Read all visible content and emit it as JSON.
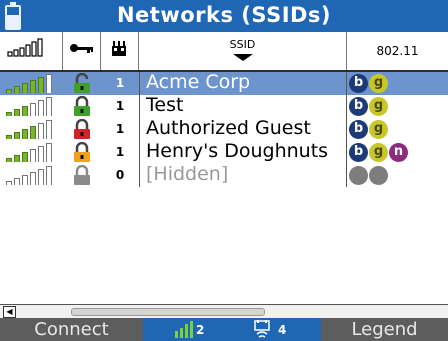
{
  "title": "Networks (SSIDs)",
  "header": {
    "signal_icon": "signal-strength-icon",
    "key_icon": "key-icon",
    "ap_icon": "access-point-icon",
    "ssid_label": "SSID",
    "std_label": "802.11"
  },
  "rows": [
    {
      "signal": 5,
      "lock": "green-open",
      "count": "1",
      "ssid": "Acme Corp",
      "standards": [
        "b",
        "g"
      ],
      "selected": true
    },
    {
      "signal": 3,
      "lock": "green",
      "count": "1",
      "ssid": "Test",
      "standards": [
        "b",
        "g"
      ]
    },
    {
      "signal": 4,
      "lock": "red",
      "count": "1",
      "ssid": "Authorized Guest",
      "standards": [
        "b",
        "g"
      ]
    },
    {
      "signal": 3,
      "lock": "orange",
      "count": "1",
      "ssid": "Henry's Doughnuts",
      "standards": [
        "b",
        "g",
        "n"
      ]
    },
    {
      "signal": 0,
      "lock": "gray",
      "count": "0",
      "ssid": "[Hidden]",
      "standards": [
        "gray",
        "gray"
      ]
    }
  ],
  "toolbar": {
    "connect": "Connect",
    "ap_count": "2",
    "client_count": "4",
    "legend": "Legend"
  },
  "colors": {
    "title_bar": "#1f66b5",
    "selected_row": "#6d94cc",
    "signal_green": "#7ab32e",
    "badge_b": "#1c3a78",
    "badge_g": "#c7c72a",
    "badge_n": "#8e2a7d",
    "toolbar": "#5d5d5d"
  }
}
